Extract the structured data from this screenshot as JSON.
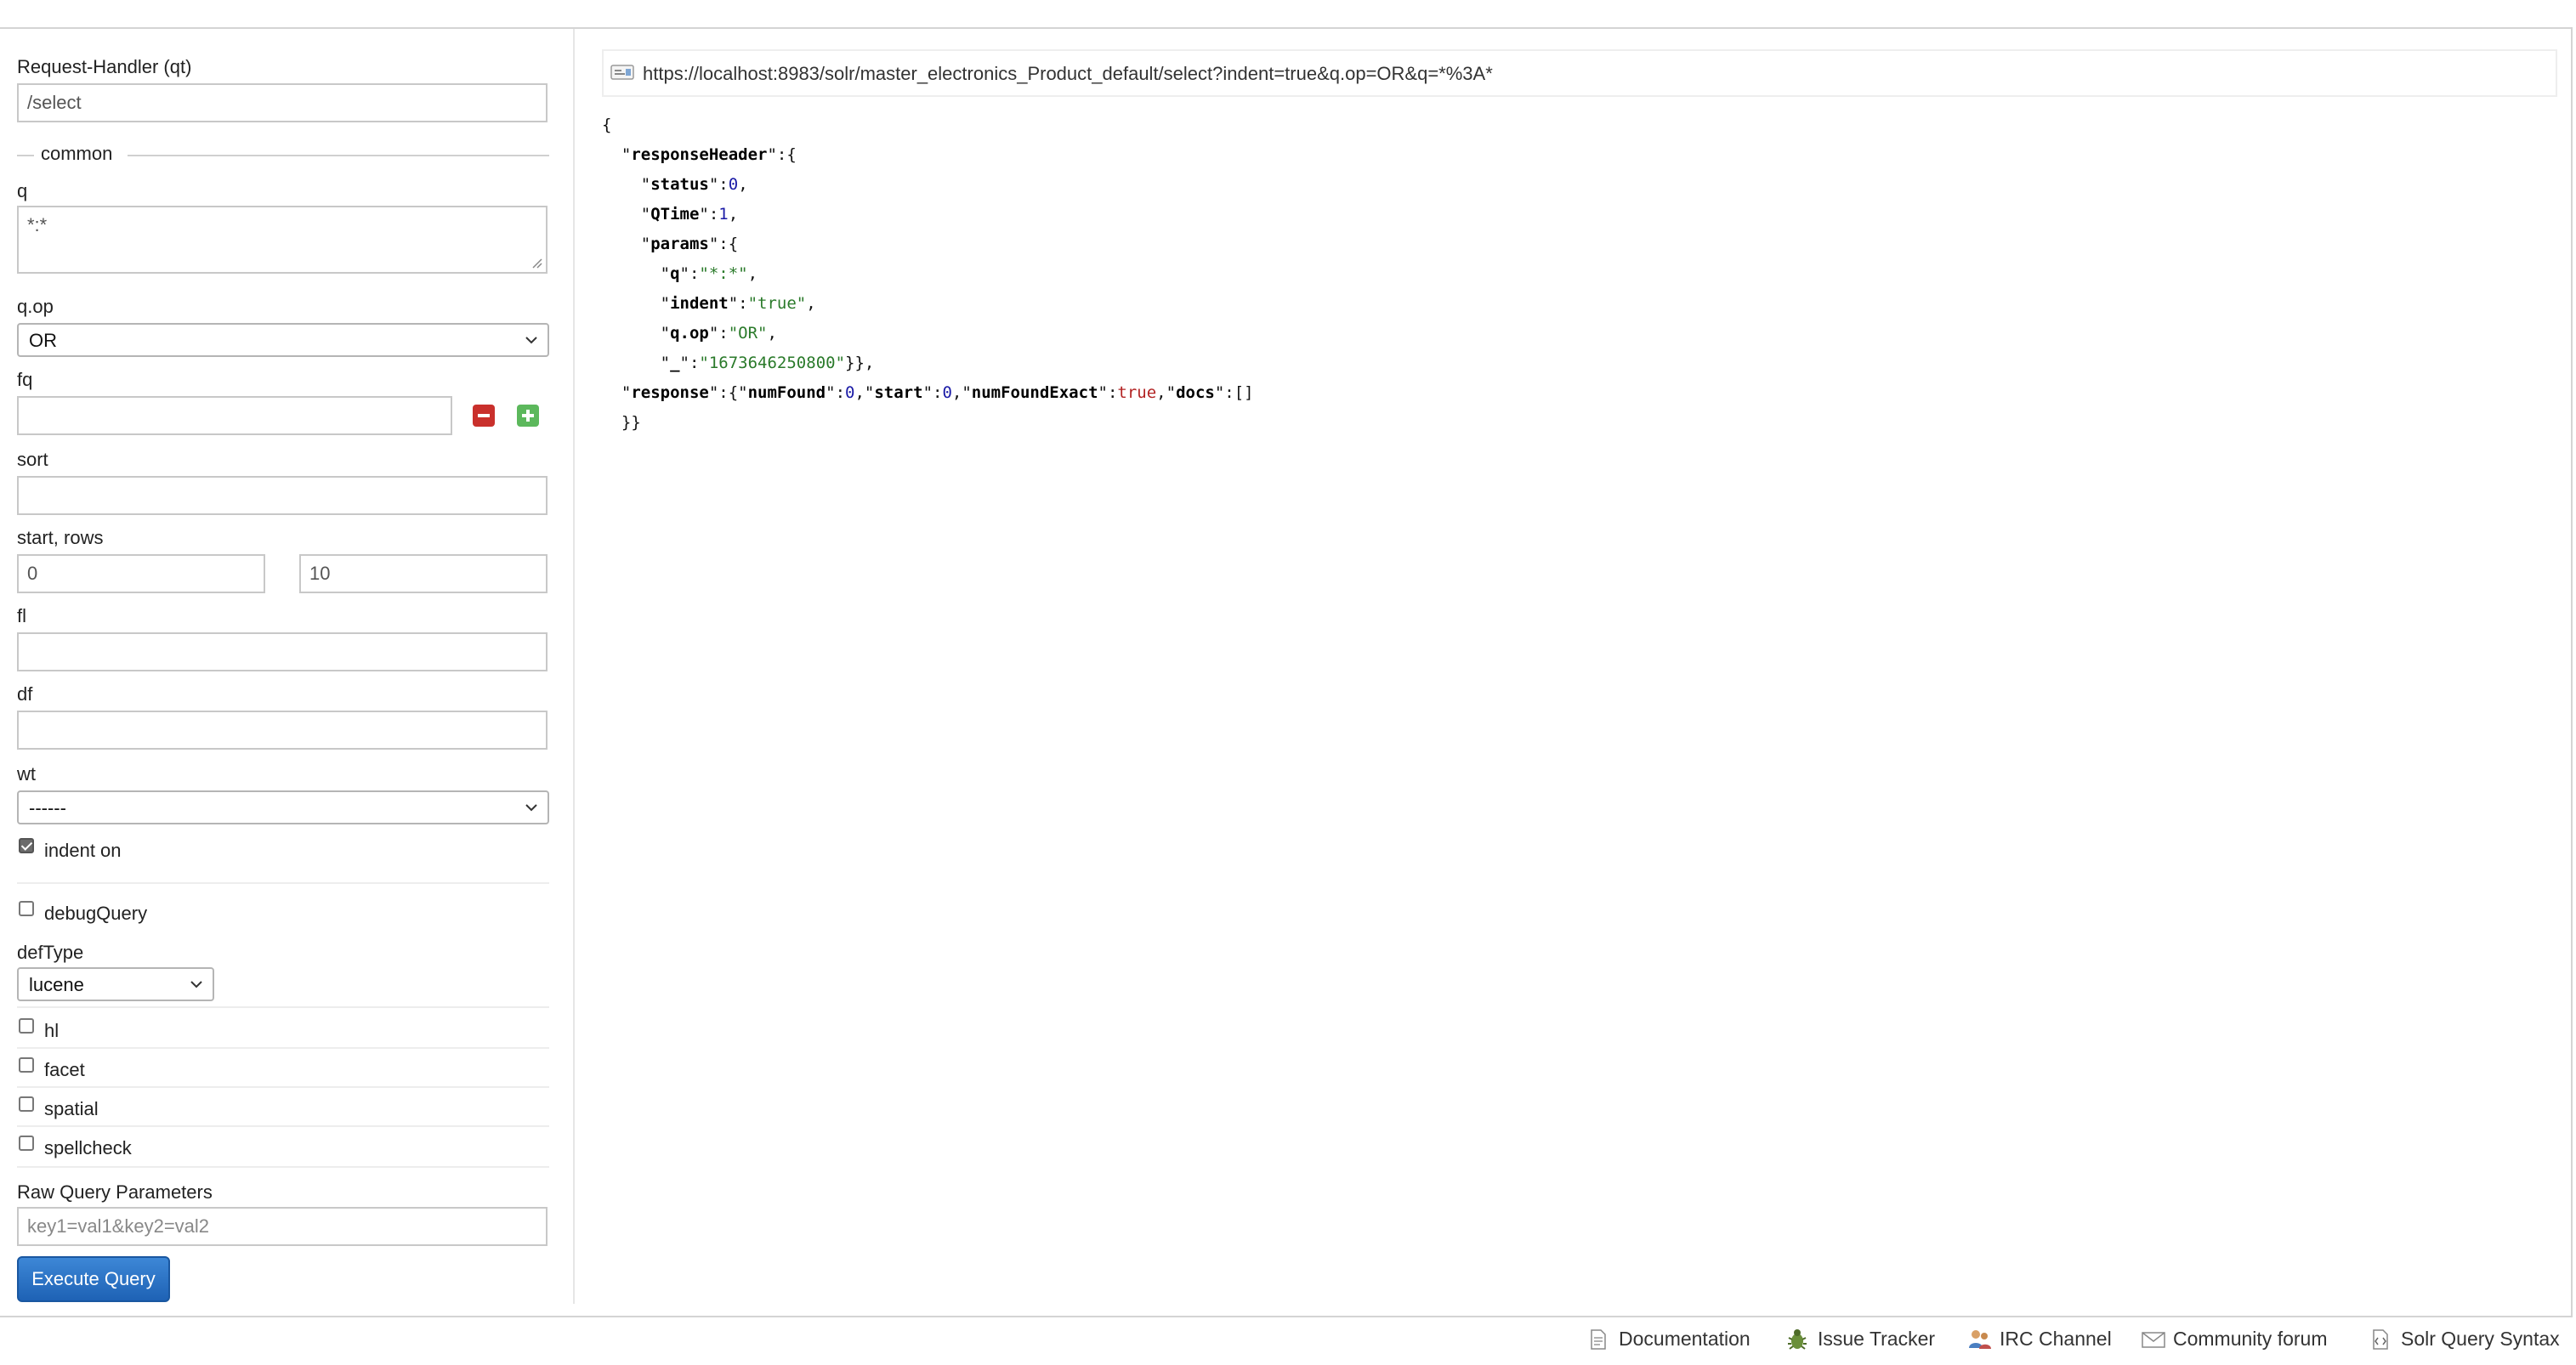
{
  "form": {
    "request_handler": {
      "label": "Request-Handler (qt)",
      "value": "/select"
    },
    "common_legend": "common",
    "q": {
      "label": "q",
      "value": "*:*"
    },
    "q_op": {
      "label": "q.op",
      "selected": "OR"
    },
    "fq": {
      "label": "fq",
      "value": ""
    },
    "sort": {
      "label": "sort",
      "value": ""
    },
    "start_rows": {
      "label": "start, rows",
      "start": "0",
      "rows": "10"
    },
    "fl": {
      "label": "fl",
      "value": ""
    },
    "df": {
      "label": "df",
      "value": ""
    },
    "wt": {
      "label": "wt",
      "selected": "------"
    },
    "indent": {
      "label": "indent on",
      "checked": true
    },
    "debug_query": {
      "label": "debugQuery",
      "checked": false
    },
    "def_type": {
      "label": "defType",
      "selected": "lucene"
    },
    "hl": {
      "label": "hl",
      "checked": false
    },
    "facet": {
      "label": "facet",
      "checked": false
    },
    "spatial": {
      "label": "spatial",
      "checked": false
    },
    "spellcheck": {
      "label": "spellcheck",
      "checked": false
    },
    "raw_params": {
      "label": "Raw Query Parameters",
      "placeholder": "key1=val1&key2=val2"
    },
    "execute_label": "Execute Query"
  },
  "result": {
    "url": "https://localhost:8983/solr/master_electronics_Product_default/select?indent=true&q.op=OR&q=*%3A*",
    "response": {
      "status": "0",
      "qtime": "1",
      "params": {
        "q": "\"*:*\"",
        "indent": "\"true\"",
        "q_op": "\"OR\"",
        "underscore": "\"1673646250800\""
      },
      "num_found": "0",
      "start": "0",
      "num_found_exact": "true"
    }
  },
  "footer": {
    "documentation": "Documentation",
    "issue_tracker": "Issue Tracker",
    "irc_channel": "IRC Channel",
    "community_forum": "Community forum",
    "query_syntax": "Solr Query Syntax"
  },
  "colors": {
    "execute_button": "#2a72c6",
    "minus_button": "#c9302c",
    "plus_button": "#5cb85c",
    "json_number": "#1a1aa6",
    "json_string": "#2a7a2a",
    "json_bool": "#b22222"
  }
}
